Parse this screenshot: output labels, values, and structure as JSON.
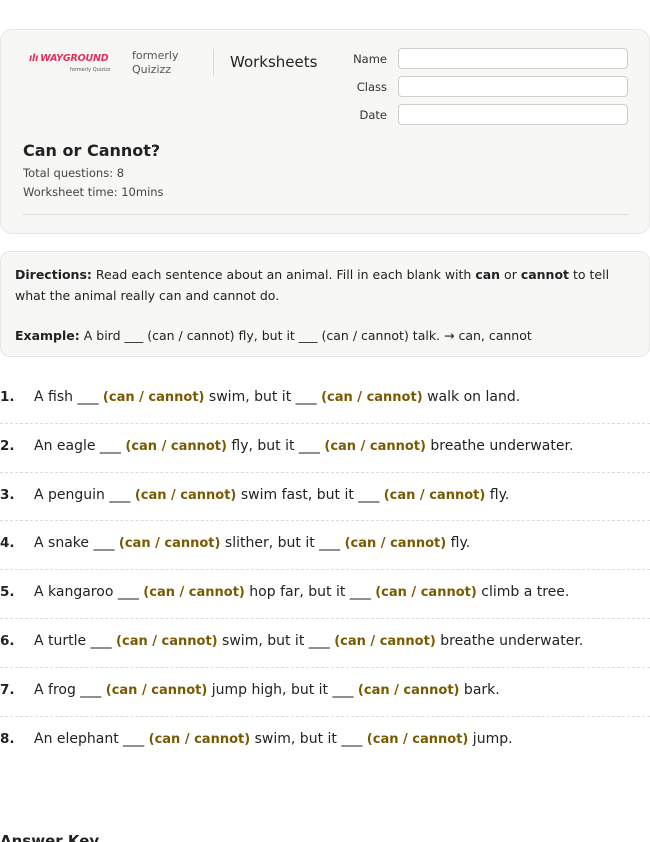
{
  "header": {
    "logo_text": "WAYGROUND",
    "logo_subtext": "formerly Quizizz",
    "formerly_line1": "formerly",
    "formerly_line2": "Quizizz",
    "section_title": "Worksheets",
    "fields": [
      {
        "label": "Name",
        "value": ""
      },
      {
        "label": "Class",
        "value": ""
      },
      {
        "label": "Date",
        "value": ""
      }
    ],
    "worksheet_title": "Can or Cannot?",
    "total_questions": "Total questions: 8",
    "worksheet_time": "Worksheet time: 10mins"
  },
  "directions": {
    "label": "Directions:",
    "text_before": " Read each sentence about an animal. Fill in each blank with ",
    "word_can": "can",
    "text_or": " or ",
    "word_cannot": "cannot",
    "text_after": " to tell what the animal really can and cannot do.",
    "example_label": "Example:",
    "example_text": " A bird ___ (can / cannot) fly, but it ___ (can / cannot) talk. → can, cannot"
  },
  "questions": [
    {
      "num": "1.",
      "a": "A fish ___ ",
      "c1": "(can / cannot)",
      "b": " swim, but it ___ ",
      "c2": "(can / cannot)",
      "d": " walk on land."
    },
    {
      "num": "2.",
      "a": "An eagle ___ ",
      "c1": "(can / cannot)",
      "b": " fly, but it ___ ",
      "c2": "(can / cannot)",
      "d": " breathe underwater."
    },
    {
      "num": "3.",
      "a": "A penguin ___ ",
      "c1": "(can / cannot)",
      "b": " swim fast, but it ___ ",
      "c2": "(can / cannot)",
      "d": " fly."
    },
    {
      "num": "4.",
      "a": "A snake ___ ",
      "c1": "(can / cannot)",
      "b": " slither, but it ___ ",
      "c2": "(can / cannot)",
      "d": " fly."
    },
    {
      "num": "5.",
      "a": "A kangaroo ___ ",
      "c1": "(can / cannot)",
      "b": " hop far, but it ___ ",
      "c2": "(can / cannot)",
      "d": " climb a tree."
    },
    {
      "num": "6.",
      "a": "A turtle ___ ",
      "c1": "(can / cannot)",
      "b": " swim, but it ___ ",
      "c2": "(can / cannot)",
      "d": " breathe underwater."
    },
    {
      "num": "7.",
      "a": "A frog ___ ",
      "c1": "(can / cannot)",
      "b": " jump high, but it ___ ",
      "c2": "(can / cannot)",
      "d": " bark."
    },
    {
      "num": "8.",
      "a": "An elephant ___ ",
      "c1": "(can / cannot)",
      "b": " swim, but it ___ ",
      "c2": "(can / cannot)",
      "d": " jump."
    }
  ],
  "answer_key_title": "Answer Key",
  "colors": {
    "brand": "#e62e5c",
    "choice": "#7a5a00",
    "card_bg": "#f7f7f6"
  }
}
